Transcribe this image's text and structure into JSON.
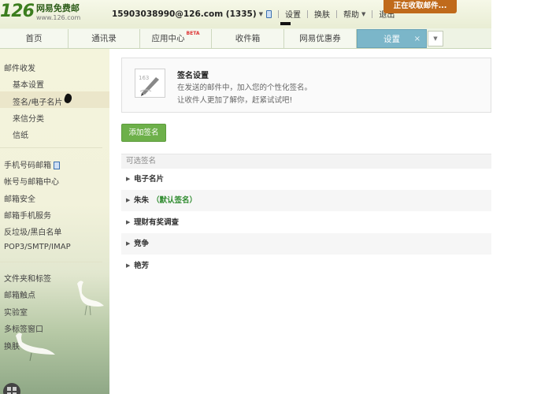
{
  "header": {
    "logo_number": "126",
    "logo_name": "网易免费邮",
    "logo_url": "www.126.com",
    "user_email": "15903038990@126.com (1335)",
    "links": [
      "设置",
      "换肤",
      "帮助",
      "退出"
    ],
    "status_button": "正在收取邮件..."
  },
  "tabs": {
    "items": [
      "首页",
      "通讯录",
      "应用中心",
      "收件箱",
      "网易优惠券",
      "设置"
    ],
    "beta_badge": "BETA",
    "close_symbol": "×",
    "more_symbol": "▼"
  },
  "sidebar": {
    "group1_title": "邮件收发",
    "group1_items": [
      "基本设置",
      "签名/电子名片",
      "来信分类",
      "信纸"
    ],
    "group2_items": [
      "手机号码邮箱",
      "帐号与邮箱中心",
      "邮箱安全",
      "邮箱手机服务",
      "反垃圾/黑白名单",
      "POP3/SMTP/IMAP"
    ],
    "group3_items": [
      "文件夹和标签",
      "邮箱触点",
      "实验室",
      "多标签窗口",
      "换肤"
    ]
  },
  "main": {
    "card": {
      "icon_label": "163",
      "title": "签名设置",
      "desc1": "在发送的邮件中，加入您的个性化签名。",
      "desc2": "让收件人更加了解你，赶紧试试吧!"
    },
    "add_button": "添加签名",
    "list_header": "可选签名",
    "signatures": [
      {
        "name": "电子名片",
        "tag": ""
      },
      {
        "name": "朱朱",
        "tag": "（默认签名）"
      },
      {
        "name": "理财有奖调查",
        "tag": ""
      },
      {
        "name": "竞争",
        "tag": ""
      },
      {
        "name": "艳芳",
        "tag": ""
      }
    ],
    "arrow_symbol": "▶"
  },
  "colors": {
    "brand_green": "#3b7d1e",
    "active_tab": "#7bb6c9",
    "add_button": "#6db04a",
    "status_button": "#c06a1b",
    "default_tag": "#2e8b2e"
  }
}
